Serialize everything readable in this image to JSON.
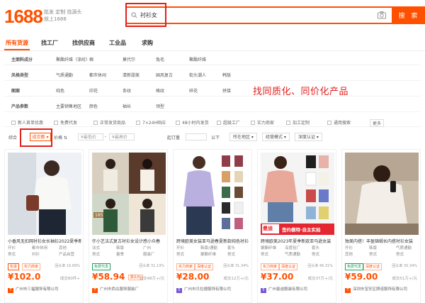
{
  "header": {
    "logo": "1688",
    "slogan": "批发 定制 找源头 就上1688",
    "search_value": "衬衫女",
    "search_button": "搜 索"
  },
  "tabs": [
    "所有货源",
    "找工厂",
    "找供应商",
    "工业品",
    "求购"
  ],
  "filters": [
    {
      "label": "主面料成分",
      "options": [
        "聚酯纤维（涤纶）",
        "棉",
        "莫代尔",
        "兔毛",
        "聚酯纤维"
      ]
    },
    {
      "label": "风格类型",
      "options": [
        "气质通勤",
        "都市休闲",
        "清新甜美",
        "国风复古",
        "街头潮人",
        "韩版"
      ]
    },
    {
      "label": "图案",
      "options": [
        "纯色",
        "印花",
        "条纹",
        "格纹",
        "碎花",
        "拼接"
      ]
    },
    {
      "label": "产品参数",
      "options": [
        "主要销售地区",
        "颜色",
        "袖长",
        "领型"
      ]
    }
  ],
  "annotation": "找同质化、同价化产品",
  "checks": [
    "新人首单优惠",
    "免费代发",
    "正常发货商品",
    "7×24H响应",
    "48小时内发货",
    "超级工厂",
    "实力商家",
    "加工定制",
    "通用搜索",
    "更多"
  ],
  "sortbar": {
    "label": "综合",
    "active": "成交额",
    "price": "价格",
    "min_placeholder": "¥最低价",
    "max_placeholder": "¥最高价",
    "moq": "起订量",
    "below": "以下",
    "location": "所在地区",
    "model": "经营模式",
    "cert": "深度认证"
  },
  "products": [
    {
      "title": "小香风无扣网衬衫女长袖衫2022夏季新款",
      "attrs": [
        "开衫",
        "都市休闲",
        "其他",
        "常式",
        "衬衫",
        "产品自营"
      ],
      "tags": [
        {
          "text": "包退",
          "type": "r"
        },
        {
          "text": "实力商家",
          "type": "o"
        }
      ],
      "rate": "回头率 16.89%",
      "price": "¥102.0",
      "sales": "成交80件+",
      "shop": "广州市三福服饰有限公司"
    },
    {
      "title": "仟小艺法式复古衬衫女设计感小众春",
      "attrs": [
        "法式",
        "韩版",
        "广州",
        "常式",
        "春季",
        "服装厂"
      ],
      "tags": [
        {
          "text": "免费代发",
          "type": "g"
        }
      ],
      "rate": "回头率 31.13%",
      "price": "¥58.94",
      "price_tag": "源头价",
      "sales": "成交48万+/元",
      "shop": "广州市西瓜服饰服装厂"
    },
    {
      "title": "跨境欧美女装亚马逊春夏新款纯色衬衫",
      "attrs": [
        "开衫",
        "韩版/通勤",
        "套头",
        "常式",
        "聚酯纤维",
        "常式"
      ],
      "tags": [
        {
          "text": "实力商家",
          "type": "o"
        },
        {
          "text": "深度认证",
          "type": "o"
        }
      ],
      "rate": "回头率 31.34%",
      "price": "¥28.00",
      "sales": "成交12万+/元",
      "shop": "广州市贝拉德服饰有限公司"
    },
    {
      "title": "跨境欧美2023年夏季新款亚马逊女装",
      "banner": "签约模特·自主实拍",
      "banner_badge": "曼迪",
      "attrs": [
        "聚酯纤维",
        "深度验厂",
        "套头",
        "常式",
        "气质通勤",
        "常式"
      ],
      "tags": [
        {
          "text": "实力商家",
          "type": "o"
        },
        {
          "text": "深度认证",
          "type": "o"
        }
      ],
      "rate": "回头率 46.31%",
      "price": "¥37.00",
      "sales": "成交37万+/元",
      "shop": "广州曼迪服装有限公司"
    },
    {
      "title": "独美内搭！丰盈锦缎长内搭衬衫女装",
      "attrs": [
        "开衫",
        "韩版",
        "气质通勤",
        "其他",
        "常式",
        "常式"
      ],
      "tags": [
        {
          "text": "免费代发",
          "type": "g"
        },
        {
          "text": "深度认证",
          "type": "o"
        }
      ],
      "rate": "回头率 30.34%",
      "price": "¥59.00",
      "sales": "成交51万+/元",
      "shop": "深圳市宝安区顾诺服饰有限公司"
    }
  ]
}
